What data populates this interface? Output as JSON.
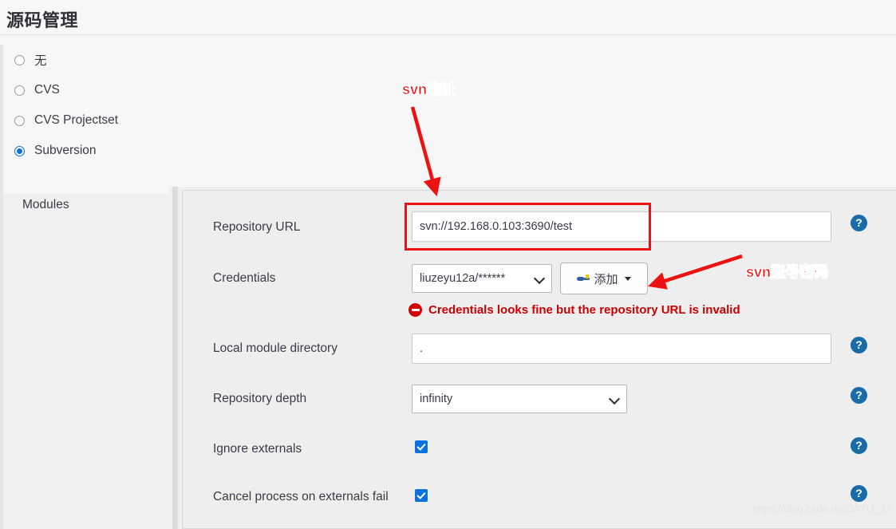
{
  "header": {
    "title": "源码管理"
  },
  "scm_type": {
    "options": [
      {
        "label": "无",
        "selected": false
      },
      {
        "label": "CVS",
        "selected": false
      },
      {
        "label": "CVS Projectset",
        "selected": false
      },
      {
        "label": "Subversion",
        "selected": true
      }
    ]
  },
  "modules_panel": {
    "label": "Modules"
  },
  "svn_form": {
    "repository_url": {
      "label": "Repository URL",
      "value": "svn://192.168.0.103:3690/test",
      "placeholder": ""
    },
    "credentials": {
      "label": "Credentials",
      "selected": "liuzeyu12a/******",
      "add_button_label": "添加",
      "add_button_icon": "key-icon",
      "error_icon": "error-circle-icon",
      "error_message": "Credentials looks fine but the repository URL is invalid"
    },
    "local_module_directory": {
      "label": "Local module directory",
      "value": ".",
      "placeholder": ""
    },
    "repository_depth": {
      "label": "Repository depth",
      "selected": "infinity"
    },
    "ignore_externals": {
      "label": "Ignore externals",
      "checked": true
    },
    "cancel_process_on_externals_fail": {
      "label": "Cancel process on externals fail",
      "checked": true
    },
    "help_icon_glyph": "?"
  },
  "annotations": [
    {
      "text": "svn地址",
      "name": "annotation-svn-url"
    },
    {
      "text": "svn账号密码",
      "name": "annotation-svn-credentials"
    }
  ],
  "watermark": {
    "text": "https://blog.csdn.net/JAYU_37"
  },
  "colors": {
    "accent_blue": "#0b72e0",
    "error_red": "#cc0000",
    "annotation_red": "#ee1111",
    "help_blue": "#1a6ca8",
    "panel_bg": "#eeeeee",
    "page_bg": "#f7f7f7"
  }
}
